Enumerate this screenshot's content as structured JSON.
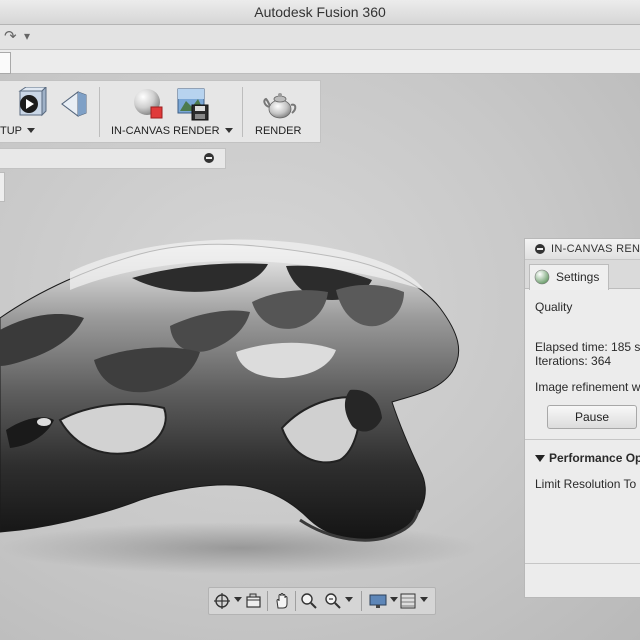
{
  "window": {
    "title": "Autodesk Fusion 360"
  },
  "quick_access": {
    "redo_glyph": "↷",
    "dropdown_glyph": "▾"
  },
  "ribbon": {
    "groups": [
      {
        "label": "TUP",
        "icons": [
          "scene-cube-icon",
          "appearance-diamond-icon"
        ]
      },
      {
        "label": "IN-CANVAS RENDER",
        "icons": [
          "in-canvas-render-sphere-icon",
          "render-save-icon"
        ]
      },
      {
        "label": "RENDER",
        "icons": [
          "render-teapot-icon"
        ]
      }
    ]
  },
  "render_panel": {
    "title": "IN-CANVAS RENDER",
    "tab_settings": "Settings",
    "quality_label": "Quality",
    "elapsed_time": "Elapsed time: 185 s",
    "iterations": "Iterations: 364",
    "refinement_text": "Image refinement w",
    "pause_label": "Pause",
    "performance_section": "Performance Op",
    "limit_resolution": "Limit Resolution To"
  },
  "navigation_bar": {
    "icons": [
      "orbit-icon",
      "look-at-icon",
      "pan-hand-icon",
      "zoom-icon",
      "zoom-window-icon",
      "display-settings-icon",
      "grid-icon"
    ]
  },
  "colors": {
    "viewport": "#c8c8c8",
    "ribbon": "#e6e6e6",
    "panel": "#ececec",
    "render_accent": "#e03a3a"
  }
}
